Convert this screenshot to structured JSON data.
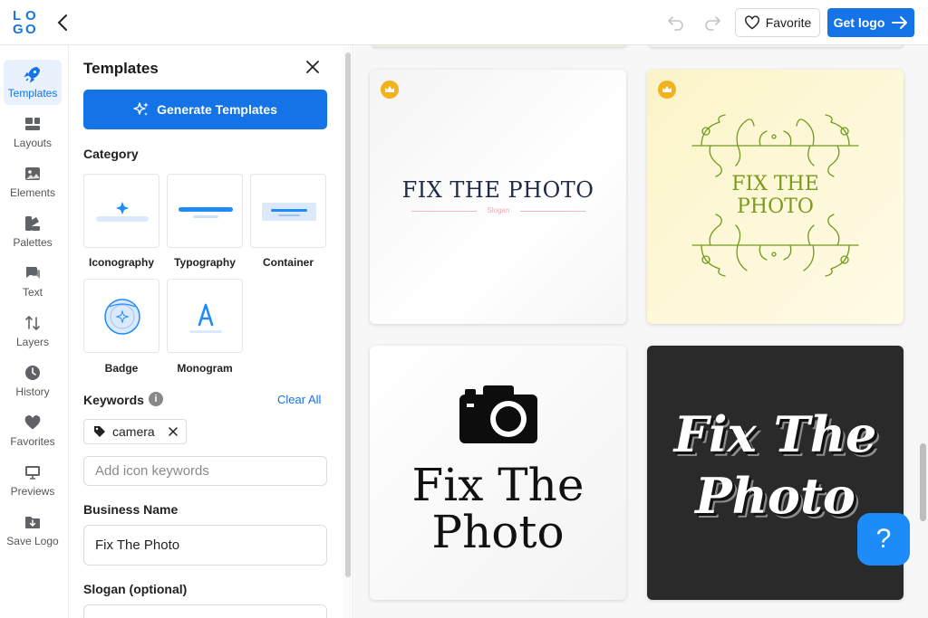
{
  "topbar": {
    "logo_letters": [
      "L",
      "O",
      "G",
      "O"
    ],
    "favorite_label": "Favorite",
    "get_logo_label": "Get logo"
  },
  "rail": {
    "items": [
      {
        "label": "Templates",
        "icon": "rocket-icon",
        "active": true
      },
      {
        "label": "Layouts",
        "icon": "layouts-icon"
      },
      {
        "label": "Elements",
        "icon": "image-icon"
      },
      {
        "label": "Palettes",
        "icon": "palette-icon"
      },
      {
        "label": "Text",
        "icon": "text-bubble-icon"
      },
      {
        "label": "Layers",
        "icon": "layers-arrows-icon"
      },
      {
        "label": "History",
        "icon": "clock-icon"
      },
      {
        "label": "Favorites",
        "icon": "heart-icon"
      },
      {
        "label": "Previews",
        "icon": "monitor-icon"
      },
      {
        "label": "Save Logo",
        "icon": "folder-download-icon"
      }
    ]
  },
  "panel": {
    "title": "Templates",
    "generate_label": "Generate Templates",
    "category_label": "Category",
    "categories": [
      {
        "label": "Iconography"
      },
      {
        "label": "Typography"
      },
      {
        "label": "Container"
      },
      {
        "label": "Badge"
      },
      {
        "label": "Monogram"
      }
    ],
    "keywords_label": "Keywords",
    "info_glyph": "i",
    "clear_all": "Clear All",
    "keyword_chip": "camera",
    "keywords_placeholder": "Add icon keywords",
    "business_name_label": "Business Name",
    "business_name_value": "Fix The Photo",
    "slogan_label": "Slogan (optional)"
  },
  "cards": [
    {
      "text": "FIX THE PHOTO",
      "slogan": "Slogan",
      "premium": true
    },
    {
      "text_line1": "FIX THE",
      "text_line2": "PHOTO",
      "premium": true
    },
    {
      "text_line1": "Fix The",
      "text_line2": "Photo",
      "premium": false
    },
    {
      "text_line1": "Fix The",
      "text_line2": "Photo",
      "premium": false
    }
  ],
  "help_glyph": "?",
  "colors": {
    "accent": "#1473e6",
    "crown": "#f2b21e",
    "card1_text": "#1f2a44",
    "card2_text": "#7a9a1e",
    "card2_bg": "#fbf6d2",
    "card4_bg": "#2a2a2a"
  }
}
